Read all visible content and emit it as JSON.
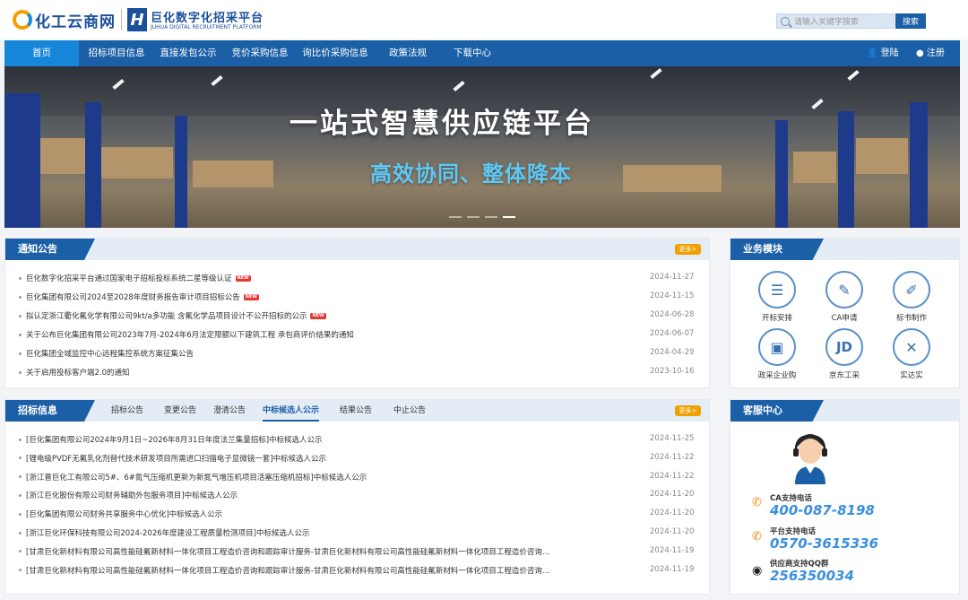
{
  "header": {
    "logo1_text": "化工云商网",
    "logo2_title": "巨化数字化招采平台",
    "logo2_subtitle": "JUHUA DIGITAL RECRUITMENT PLATFORM",
    "search_placeholder": "请输入关键字搜索",
    "search_button": "搜索"
  },
  "nav": {
    "items": [
      "首页",
      "招标项目信息",
      "直接发包公示",
      "竞价采购信息",
      "询比价采购信息",
      "政策法规",
      "下载中心"
    ],
    "login": "登陆",
    "register": "注册"
  },
  "banner": {
    "headline": "一站式智慧供应链平台",
    "subline": "高效协同、整体降本"
  },
  "notice": {
    "title": "通知公告",
    "more": "更多>",
    "items": [
      {
        "text": "巨化数字化招采平台通过国家电子招标投标系统二星等级认证",
        "date": "2024-11-27",
        "new": true
      },
      {
        "text": "巨化集团有限公司2024至2028年度财务报告审计项目招标公告",
        "date": "2024-11-15",
        "new": true
      },
      {
        "text": "拟认定浙江衢化氟化学有限公司9kt/a多功能 含氟化学品项目设计不公开招标的公示",
        "date": "2024-06-28",
        "new": true
      },
      {
        "text": "关于公布巨化集团有限公司2023年7月-2024年6月法定限额以下建筑工程 承包商评价结果的通知",
        "date": "2024-06-07",
        "new": false
      },
      {
        "text": "巨化集团全域监控中心远程集控系统方案征集公告",
        "date": "2024-04-29",
        "new": false
      },
      {
        "text": "关于启用投标客户端2.0的通知",
        "date": "2023-10-16",
        "new": false
      }
    ],
    "new_label": "NEW"
  },
  "tender": {
    "title": "招标信息",
    "more": "更多>",
    "tabs": [
      "招标公告",
      "变更公告",
      "澄清公告",
      "中标候选人公示",
      "结果公告",
      "中止公告"
    ],
    "active_tab": "中标候选人公示",
    "items": [
      {
        "text": "[巨化集团有限公司2024年9月1日~2026年8月31日年度法兰集量招标]中标候选人公示",
        "date": "2024-11-25"
      },
      {
        "text": "[锂电级PVDF无氟乳化剂替代技术研发项目所需进口扫描电子显微镜一套]中标候选人公示",
        "date": "2024-11-22"
      },
      {
        "text": "[浙江晋巨化工有限公司5#、6#氮气压缩机更新为新氮气增压机项目活塞压缩机招标]中标候选人公示",
        "date": "2024-11-22"
      },
      {
        "text": "[浙江巨化股份有限公司财务辅助外包服务项目]中标候选人公示",
        "date": "2024-11-20"
      },
      {
        "text": "[巨化集团有限公司财务共享服务中心优化]中标候选人公示",
        "date": "2024-11-20"
      },
      {
        "text": "[浙江巨化环保科技有限公司2024-2026年度建设工程质量检测项目]中标候选人公示",
        "date": "2024-11-20"
      },
      {
        "text": "[甘肃巨化新材料有限公司高性能硅氟新材料一体化项目工程造价咨询和跟踪审计服务-甘肃巨化新材料有限公司高性能硅氟新材料一体化项目工程造价咨询...",
        "date": "2024-11-19"
      },
      {
        "text": "[甘肃巨化新材料有限公司高性能硅氟新材料一体化项目工程造价咨询和跟踪审计服务-甘肃巨化新材料有限公司高性能硅氟新材料一体化项目工程造价咨询...",
        "date": "2024-11-19"
      }
    ]
  },
  "business": {
    "title": "业务模块",
    "items": [
      {
        "label": "开标安排",
        "icon": "document-list-icon"
      },
      {
        "label": "CA申请",
        "icon": "certificate-icon"
      },
      {
        "label": "标书制作",
        "icon": "document-edit-icon"
      },
      {
        "label": "政采企业购",
        "icon": "shop-icon"
      },
      {
        "label": "京东工采",
        "icon": "jd-logo-icon"
      },
      {
        "label": "实达实",
        "icon": "shidashi-logo-icon"
      }
    ],
    "jd_glyph": "JD"
  },
  "service": {
    "title": "客服中心",
    "ca_label": "CA支持电话",
    "ca_phone": "400-087-8198",
    "platform_label": "平台支持电话",
    "platform_phone": "0570-3615336",
    "qq_label": "供应商支持QQ群",
    "qq_number": "256350034"
  }
}
